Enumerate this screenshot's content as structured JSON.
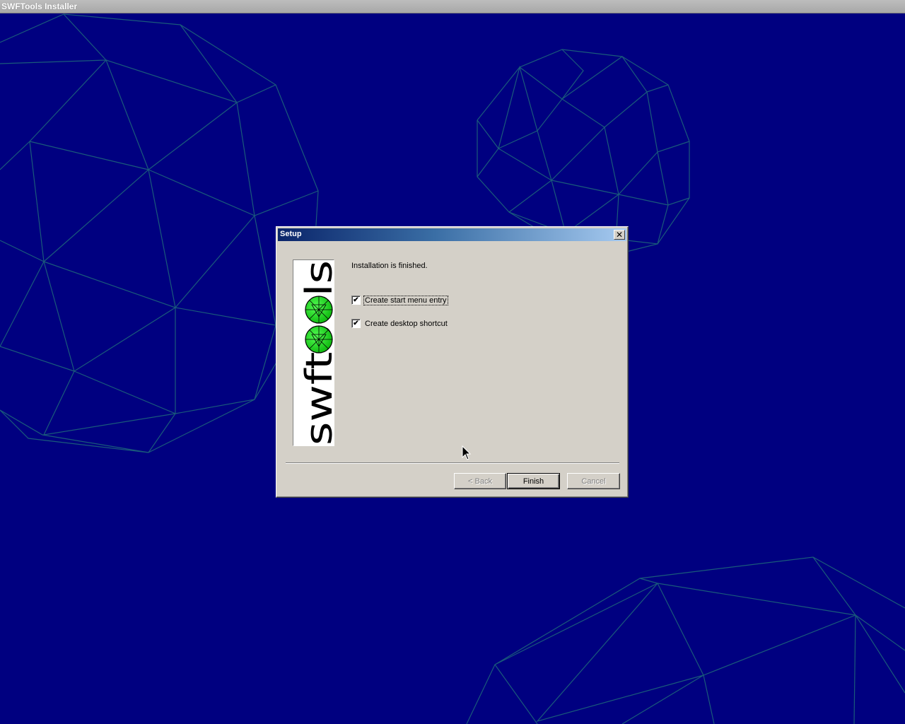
{
  "window": {
    "title": "SWFTools Installer"
  },
  "dialog": {
    "title": "Setup",
    "close_label": "✕",
    "logo_text": "swftools",
    "status": "Installation is finished.",
    "options": [
      {
        "label": "Create start menu entry",
        "checked": true,
        "check_glyph": "✔"
      },
      {
        "label": "Create desktop shortcut",
        "checked": true,
        "check_glyph": "✔"
      }
    ],
    "buttons": {
      "back": "< Back",
      "finish": "Finish",
      "cancel": "Cancel"
    }
  },
  "colors": {
    "desktop": "#000080",
    "wireframe": "#1a5a7a",
    "dialog_face": "#d4d0c8",
    "logo_ball": "#22dd22"
  },
  "icons": [
    "close-icon",
    "check-icon",
    "mouse-cursor-icon",
    "swftools-logo"
  ]
}
